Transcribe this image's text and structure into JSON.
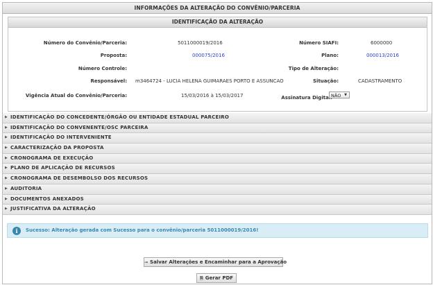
{
  "main_title": "INFORMAÇÕES DA ALTERAÇÃO DO CONVÊNIO/PARCERIA",
  "ident": {
    "title": "IDENTIFICAÇÃO DA ALTERAÇÃO",
    "numero_convenio_label": "Número do Convênio/Parceria:",
    "numero_convenio_value": "5011000019/2016",
    "numero_siafi_label": "Número SIAFI:",
    "numero_siafi_value": "6000000",
    "proposta_label": "Proposta:",
    "proposta_value": "000075/2016",
    "plano_label": "Plano:",
    "plano_value": "000013/2016",
    "numero_controle_label": "Número Controle:",
    "tipo_alteracao_label": "Tipo de Alteração:",
    "responsavel_label": "Responsável:",
    "responsavel_value": "m3464724 - LUCIA HELENA GUIMARAES PORTO E ASSUNCAO",
    "situacao_label": "Situação:",
    "situacao_value": "CADASTRAMENTO",
    "vigencia_label": "Vigência Atual do Convênio/Parceria:",
    "vigencia_value": "15/03/2016 à 15/03/2017",
    "assinatura_label": "Assinatura Digital:",
    "assinatura_value": "NÃO"
  },
  "sections": [
    "IDENTIFICAÇÃO DO CONCEDENTE/ÓRGÃO OU ENTIDADE ESTADUAL PARCEIRO",
    "IDENTIFICAÇÃO DO CONVENENTE/OSC PARCEIRA",
    "IDENTIFICAÇÃO DO INTERVENIENTE",
    "CARACTERIZAÇÃO DA PROPOSTA",
    "CRONOGRAMA DE EXECUÇÃO",
    "PLANO DE APLICAÇÃO DE RECURSOS",
    "CRONOGRAMA DE DESEMBOLSO DOS RECURSOS",
    "AUDITORIA",
    "DOCUMENTOS ANEXADOS",
    "JUSTIFICATIVA DA ALTERAÇÃO"
  ],
  "alert": {
    "message": "Sucesso: Alteração gerada com Sucesso para o convênio/parceria 5011000019/2016!"
  },
  "buttons": {
    "save_label": "Salvar Alterações e Encaminhar para a Aprovação",
    "pdf_label": "Gerar PDF"
  }
}
